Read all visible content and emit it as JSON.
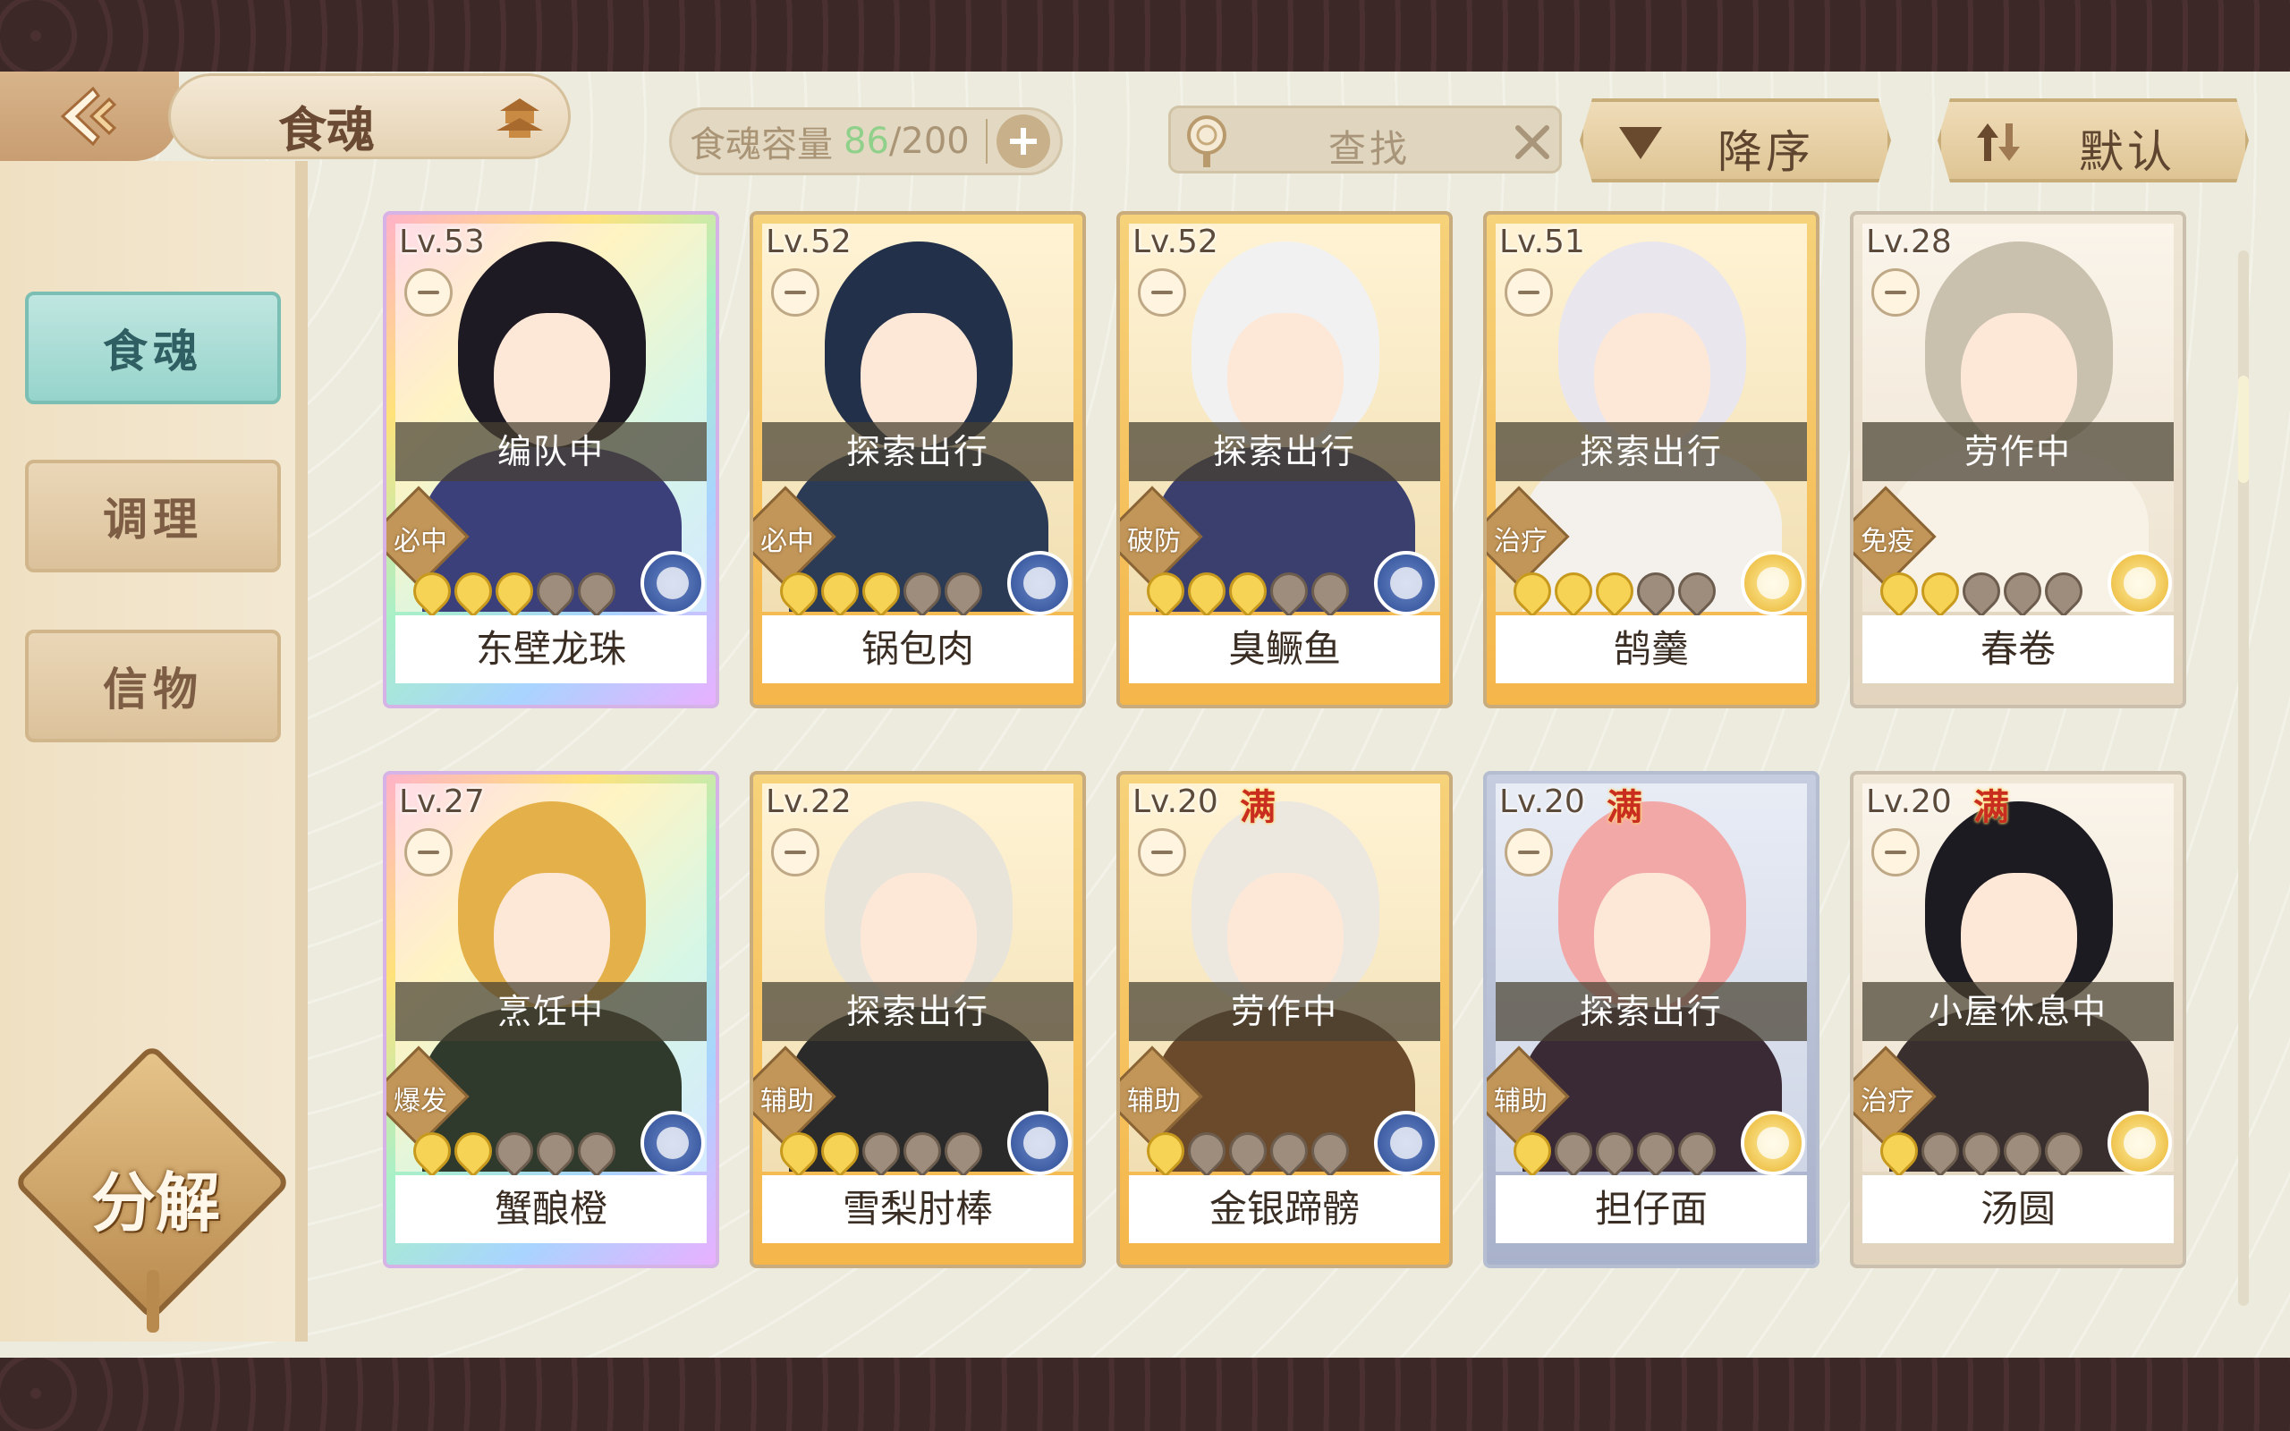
{
  "header": {
    "title": "食魂",
    "capacity_label": "食魂容量",
    "capacity_current": "86",
    "capacity_total": "/200",
    "search_placeholder": "查找",
    "sort_order_label": "降序",
    "sort_mode_label": "默认"
  },
  "sidebar": {
    "items": [
      {
        "label": "食魂",
        "active": true
      },
      {
        "label": "调理",
        "active": false
      },
      {
        "label": "信物",
        "active": false
      }
    ],
    "decompose_label": "分解"
  },
  "cards": [
    {
      "level": "Lv.53",
      "status": "编队中",
      "role": "必中",
      "name": "东壁龙珠",
      "stars": 3,
      "total_stars": 5,
      "element": "blue",
      "frame": "rainbow",
      "full": false
    },
    {
      "level": "Lv.52",
      "status": "探索出行",
      "role": "必中",
      "name": "锅包肉",
      "stars": 3,
      "total_stars": 5,
      "element": "blue",
      "frame": "gold",
      "full": false
    },
    {
      "level": "Lv.52",
      "status": "探索出行",
      "role": "破防",
      "name": "臭鳜鱼",
      "stars": 3,
      "total_stars": 5,
      "element": "blue",
      "frame": "gold",
      "full": false
    },
    {
      "level": "Lv.51",
      "status": "探索出行",
      "role": "治疗",
      "name": "鹄羹",
      "stars": 3,
      "total_stars": 5,
      "element": "gold",
      "frame": "gold",
      "full": false
    },
    {
      "level": "Lv.28",
      "status": "劳作中",
      "role": "免疫",
      "name": "春卷",
      "stars": 2,
      "total_stars": 5,
      "element": "gold",
      "frame": "pale",
      "full": false
    },
    {
      "level": "Lv.27",
      "status": "烹饪中",
      "role": "爆发",
      "name": "蟹酿橙",
      "stars": 2,
      "total_stars": 5,
      "element": "blue",
      "frame": "rainbow",
      "full": false
    },
    {
      "level": "Lv.22",
      "status": "探索出行",
      "role": "辅助",
      "name": "雪梨肘棒",
      "stars": 2,
      "total_stars": 5,
      "element": "blue",
      "frame": "gold",
      "full": false
    },
    {
      "level": "Lv.20",
      "status": "劳作中",
      "role": "辅助",
      "name": "金银蹄髈",
      "stars": 1,
      "total_stars": 5,
      "element": "blue",
      "frame": "gold",
      "full": true
    },
    {
      "level": "Lv.20",
      "status": "探索出行",
      "role": "辅助",
      "name": "担仔面",
      "stars": 1,
      "total_stars": 5,
      "element": "gold",
      "frame": "silver",
      "full": true
    },
    {
      "level": "Lv.20",
      "status": "小屋休息中",
      "role": "治疗",
      "name": "汤圆",
      "stars": 1,
      "total_stars": 5,
      "element": "gold",
      "frame": "pale",
      "full": true
    }
  ],
  "full_badge_label": "满",
  "colors": {
    "accent_teal": "#96d4cb",
    "capacity_green": "#8fd08a",
    "full_badge_red": "#c92d1f"
  }
}
